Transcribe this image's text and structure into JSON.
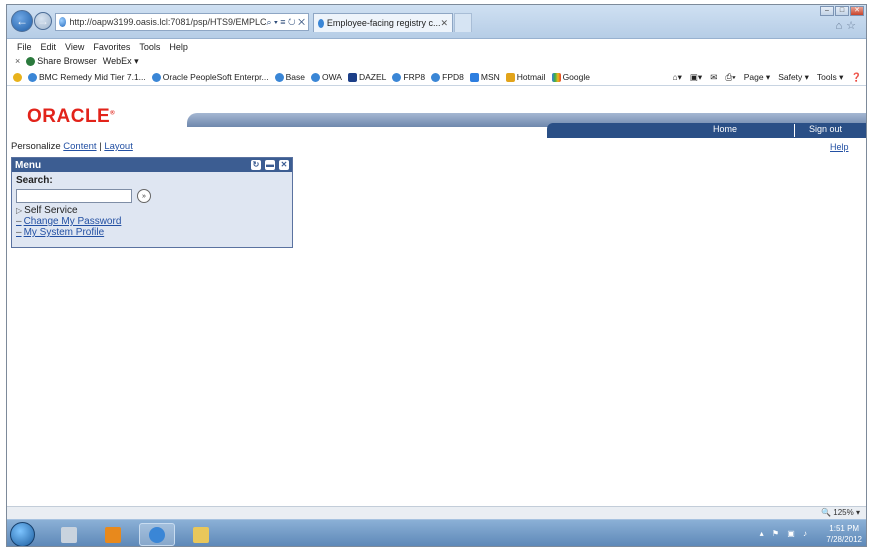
{
  "browser": {
    "address_url": "http://oapw3199.oasis.lcl:7081/psp/HTS9/EMPLC",
    "address_controls": "⌕ ▾ ≡ ↻ ✕",
    "tab_title": "Employee-facing registry c...",
    "tab_close": "✕",
    "menu": [
      "File",
      "Edit",
      "View",
      "Favorites",
      "Tools",
      "Help"
    ],
    "share_browser": "Share Browser",
    "webex": "WebEx ▾",
    "favorites": [
      {
        "label": "BMC Remedy Mid Tier 7.1...",
        "icon": "ie"
      },
      {
        "label": "Oracle PeopleSoft Enterpr...",
        "icon": "ie"
      },
      {
        "label": "Base",
        "icon": "ie"
      },
      {
        "label": "OWA",
        "icon": "ie"
      },
      {
        "label": "DAZEL",
        "icon": "dz"
      },
      {
        "label": "FRP8",
        "icon": "ie"
      },
      {
        "label": "FPD8",
        "icon": "ie"
      },
      {
        "label": "MSN",
        "icon": "msn"
      },
      {
        "label": "Hotmail",
        "icon": "hm"
      },
      {
        "label": "Google",
        "icon": "gg"
      }
    ],
    "command_bar": [
      "Page ▾",
      "Safety ▾",
      "Tools ▾"
    ],
    "zoom_level": " 125%"
  },
  "page": {
    "logo": "ORACLE",
    "logo_mark": "®",
    "header_links": {
      "home": "Home",
      "signout": "Sign out"
    },
    "help": "Help",
    "personalize": {
      "prefix": "Personalize ",
      "content": "Content",
      "separator": " | ",
      "layout": "Layout"
    },
    "menu": {
      "title": "Menu",
      "search_label": "Search:",
      "search_value": "",
      "go_button": "»",
      "items": [
        {
          "label": "Self Service",
          "type": "folder"
        },
        {
          "label": "Change My Password",
          "type": "link"
        },
        {
          "label": "My System Profile",
          "type": "link"
        }
      ]
    }
  },
  "taskbar": {
    "time": "1:51 PM",
    "date": "7/28/2012"
  },
  "colors": {
    "oracle_red": "#e2231a",
    "header_blue": "#2a4f86",
    "link_blue": "#2350a3",
    "menu_header": "#3c5d92"
  }
}
